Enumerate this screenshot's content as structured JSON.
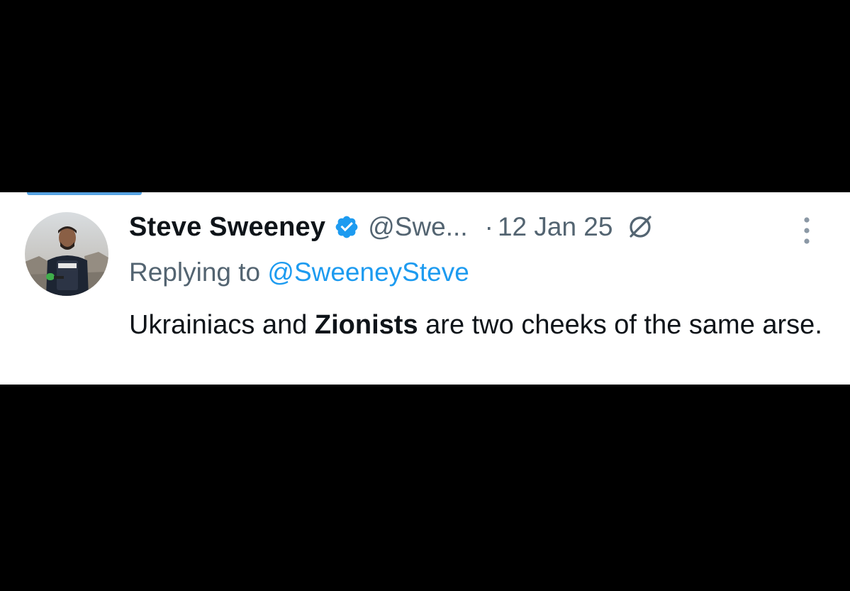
{
  "colors": {
    "background": "#000000",
    "card": "#ffffff",
    "primary_text": "#0f1419",
    "secondary_text": "#536471",
    "link": "#1d9bf0",
    "verified_badge": "#1d9bf0",
    "tab_indicator": "#56a3e3"
  },
  "tweet": {
    "avatar_icon": "avatar-photo",
    "display_name": "Steve Sweeney",
    "verified_icon": "verified-badge-icon",
    "handle": "@Swe...",
    "separator": "·",
    "timestamp": "12 Jan 25",
    "grok_icon": "grok-icon",
    "more_icon": "more-vertical-icon",
    "replying_to_prefix": "Replying to ",
    "replying_to_handle": "@SweeneySteve",
    "text_part1": "Ukrainiacs and ",
    "text_bold": "Zionists",
    "text_part2": " are two cheeks of the same arse."
  }
}
